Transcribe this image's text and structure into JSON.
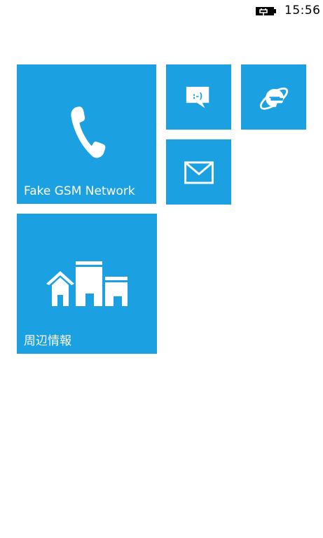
{
  "status_bar": {
    "time": "15:56",
    "battery_icon": "battery-charging-icon"
  },
  "tiles": {
    "phone": {
      "label": "Fake GSM Network",
      "icon": "phone-icon"
    },
    "messaging": {
      "label": "",
      "icon": "messaging-icon",
      "emoticon": ":-)"
    },
    "ie": {
      "label": "",
      "icon": "internet-explorer-icon"
    },
    "mail": {
      "label": "",
      "icon": "mail-icon"
    },
    "local_scout": {
      "label": "周辺情報",
      "icon": "local-scout-icon"
    }
  },
  "colors": {
    "tile_accent": "#1ba1e2",
    "background": "#ffffff"
  }
}
